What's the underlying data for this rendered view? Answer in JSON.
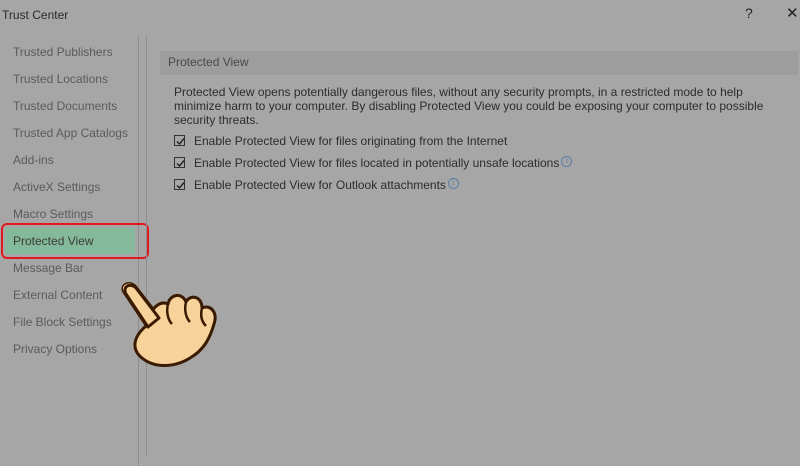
{
  "window": {
    "title": "Trust Center",
    "help": "?",
    "close": "✕"
  },
  "sidebar": {
    "items": [
      {
        "label": "Trusted Publishers"
      },
      {
        "label": "Trusted Locations"
      },
      {
        "label": "Trusted Documents"
      },
      {
        "label": "Trusted App Catalogs"
      },
      {
        "label": "Add-ins"
      },
      {
        "label": "ActiveX Settings"
      },
      {
        "label": "Macro Settings"
      },
      {
        "label": "Protected View"
      },
      {
        "label": "Message Bar"
      },
      {
        "label": "External Content"
      },
      {
        "label": "File Block Settings"
      },
      {
        "label": "Privacy Options"
      }
    ],
    "selected": "Protected View"
  },
  "main": {
    "section_title": "Protected View",
    "description": "Protected View opens potentially dangerous files, without any security prompts, in a restricted mode to help minimize harm to your computer. By disabling Protected View you could be exposing your computer to possible security threats.",
    "options": [
      {
        "label": "Enable Protected View for files originating from the Internet",
        "checked": true
      },
      {
        "label": "Enable Protected View for files located in potentially unsafe locations",
        "checked": true
      },
      {
        "label": "Enable Protected View for Outlook attachments",
        "checked": true
      }
    ]
  },
  "colors": {
    "selected_bg": "#84b99b",
    "highlight_border": "#e0191f",
    "background": "#a6a6a6"
  },
  "overlay": {
    "icon": "pointing-hand-icon"
  }
}
